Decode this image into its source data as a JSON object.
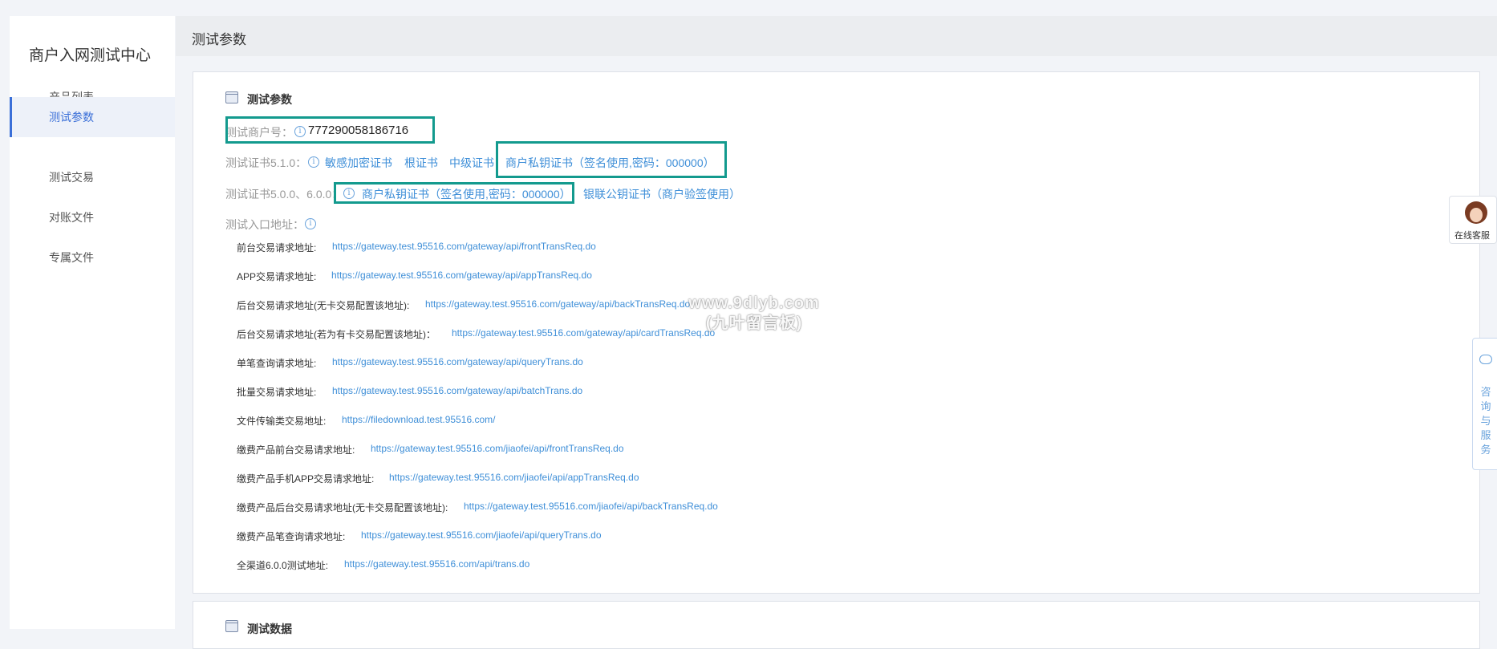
{
  "sidebar": {
    "title": "商户入网测试中心",
    "items": [
      {
        "label": "产品列表"
      },
      {
        "label": "测试参数"
      },
      {
        "label": "测试交易"
      },
      {
        "label": "对账文件"
      },
      {
        "label": "专属文件"
      }
    ]
  },
  "header": {
    "title": "测试参数"
  },
  "params": {
    "section_title": "测试参数",
    "merchant_label": "测试商户号：",
    "merchant_id": "777290058186716",
    "cert510_label": "测试证书5.1.0：",
    "cert510_links": [
      "敏感加密证书",
      "根证书",
      "中级证书",
      "商户私钥证书（签名使用,密码：000000）"
    ],
    "cert500_label": "测试证书5.0.0、6.0.0：",
    "cert500_links": [
      "商户私钥证书（签名使用,密码：000000）",
      "银联公钥证书（商户验签使用）"
    ],
    "entry_label": "测试入口地址：",
    "info_glyph": "i"
  },
  "endpoints": [
    {
      "label": "前台交易请求地址:",
      "url": "https://gateway.test.95516.com/gateway/api/frontTransReq.do"
    },
    {
      "label": "APP交易请求地址:",
      "url": "https://gateway.test.95516.com/gateway/api/appTransReq.do"
    },
    {
      "label": "后台交易请求地址(无卡交易配置该地址):",
      "url": "https://gateway.test.95516.com/gateway/api/backTransReq.do"
    },
    {
      "label": "后台交易请求地址(若为有卡交易配置该地址)：",
      "url": "https://gateway.test.95516.com/gateway/api/cardTransReq.do"
    },
    {
      "label": "单笔查询请求地址:",
      "url": "https://gateway.test.95516.com/gateway/api/queryTrans.do"
    },
    {
      "label": "批量交易请求地址:",
      "url": "https://gateway.test.95516.com/gateway/api/batchTrans.do"
    },
    {
      "label": "文件传输类交易地址:",
      "url": "https://filedownload.test.95516.com/"
    },
    {
      "label": "缴费产品前台交易请求地址:",
      "url": "https://gateway.test.95516.com/jiaofei/api/frontTransReq.do"
    },
    {
      "label": "缴费产品手机APP交易请求地址:",
      "url": "https://gateway.test.95516.com/jiaofei/api/appTransReq.do"
    },
    {
      "label": "缴费产品后台交易请求地址(无卡交易配置该地址):",
      "url": "https://gateway.test.95516.com/jiaofei/api/backTransReq.do"
    },
    {
      "label": "缴费产品笔查询请求地址:",
      "url": "https://gateway.test.95516.com/jiaofei/api/queryTrans.do"
    },
    {
      "label": "全渠道6.0.0测试地址:",
      "url": "https://gateway.test.95516.com/api/trans.do"
    }
  ],
  "next_section": {
    "title": "测试数据"
  },
  "widgets": {
    "online_service": "在线客服",
    "consult_service": "咨询与服务"
  },
  "watermark": {
    "line1": "www.9dlyb.com",
    "line2": "(九叶留言板)"
  },
  "colors": {
    "highlight": "#139a8e",
    "link": "#3f8fd8",
    "active_nav": "#3a6fd8"
  }
}
